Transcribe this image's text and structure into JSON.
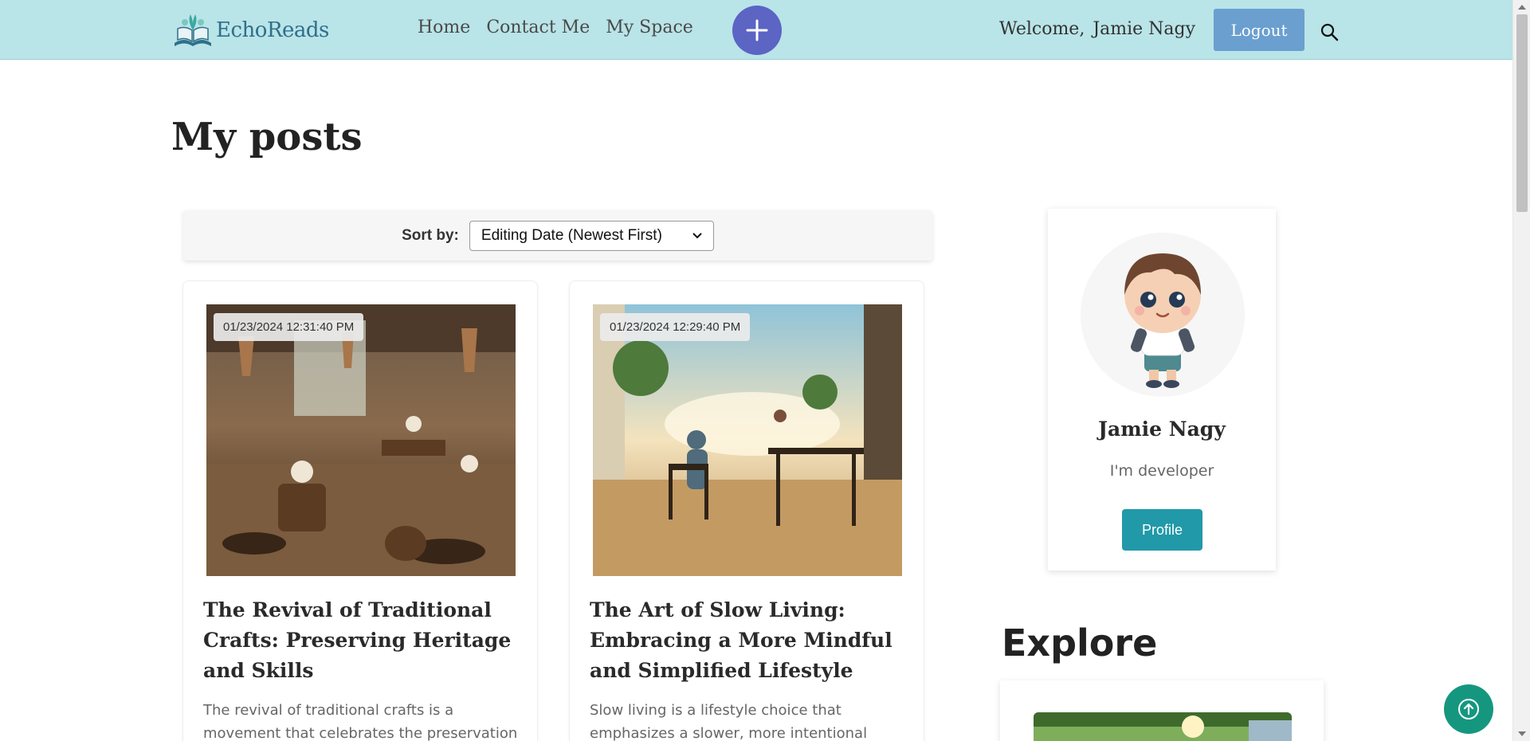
{
  "header": {
    "logo_text": "EchoReads",
    "nav": [
      "Home",
      "Contact Me",
      "My Space"
    ],
    "welcome_label": "Welcome,",
    "user_name": "Jamie Nagy",
    "logout_label": "Logout",
    "accent_color": "#5c64c4",
    "header_color": "#b9e4e8"
  },
  "page": {
    "title": "My posts"
  },
  "sort": {
    "label": "Sort by:",
    "selected": "Editing Date (Newest First)"
  },
  "posts": [
    {
      "date": "01/23/2024 12:31:40 PM",
      "title": "The Revival of Traditional Crafts: Preserving Heritage and Skills",
      "excerpt": "The revival of traditional crafts is a movement that celebrates the preservation of heritage"
    },
    {
      "date": "01/23/2024 12:29:40 PM",
      "title": "The Art of Slow Living: Embracing a More Mindful and Simplified Lifestyle",
      "excerpt": "Slow living is a lifestyle choice that emphasizes a slower, more intentional approach to daily"
    }
  ],
  "profile": {
    "name": "Jamie Nagy",
    "bio": "I'm developer",
    "button_label": "Profile"
  },
  "explore": {
    "title": "Explore"
  },
  "icons": {
    "add": "plus-icon",
    "search": "search-icon",
    "back_to_top": "arrow-up-icon"
  }
}
